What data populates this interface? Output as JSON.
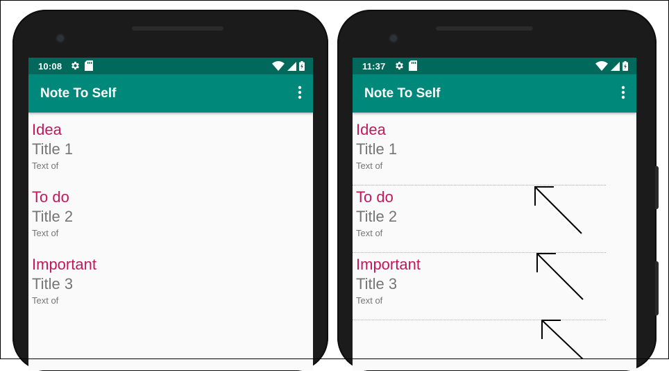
{
  "colors": {
    "status_bar": "#00695c",
    "app_bar": "#00897b",
    "note_type": "#c2185b",
    "note_title": "#757575",
    "background": "#fafafa"
  },
  "screens": [
    {
      "status": {
        "time": "10:08",
        "icons": [
          "gear-icon",
          "sd-card-icon",
          "wifi-icon",
          "signal-icon",
          "battery-icon"
        ]
      },
      "app_bar": {
        "title": "Note To Self",
        "menu_icon": "overflow-menu-icon"
      },
      "notes": [
        {
          "type": "Idea",
          "title": "Title 1",
          "text": "Text of"
        },
        {
          "type": "To do",
          "title": "Title 2",
          "text": "Text of"
        },
        {
          "type": "Important",
          "title": "Title 3",
          "text": "Text of"
        }
      ]
    },
    {
      "status": {
        "time": "11:37",
        "icons": [
          "gear-icon",
          "sd-card-icon",
          "wifi-icon",
          "signal-icon",
          "battery-icon"
        ]
      },
      "app_bar": {
        "title": "Note To Self",
        "menu_icon": "overflow-menu-icon"
      },
      "notes": [
        {
          "type": "Idea",
          "title": "Title 1",
          "text": "Text of"
        },
        {
          "type": "To do",
          "title": "Title 2",
          "text": "Text of"
        },
        {
          "type": "Important",
          "title": "Title 3",
          "text": "Text of"
        }
      ]
    }
  ],
  "annotations": {
    "arrow_count": 3,
    "arrow_icon": "pointer-arrow-icon"
  }
}
